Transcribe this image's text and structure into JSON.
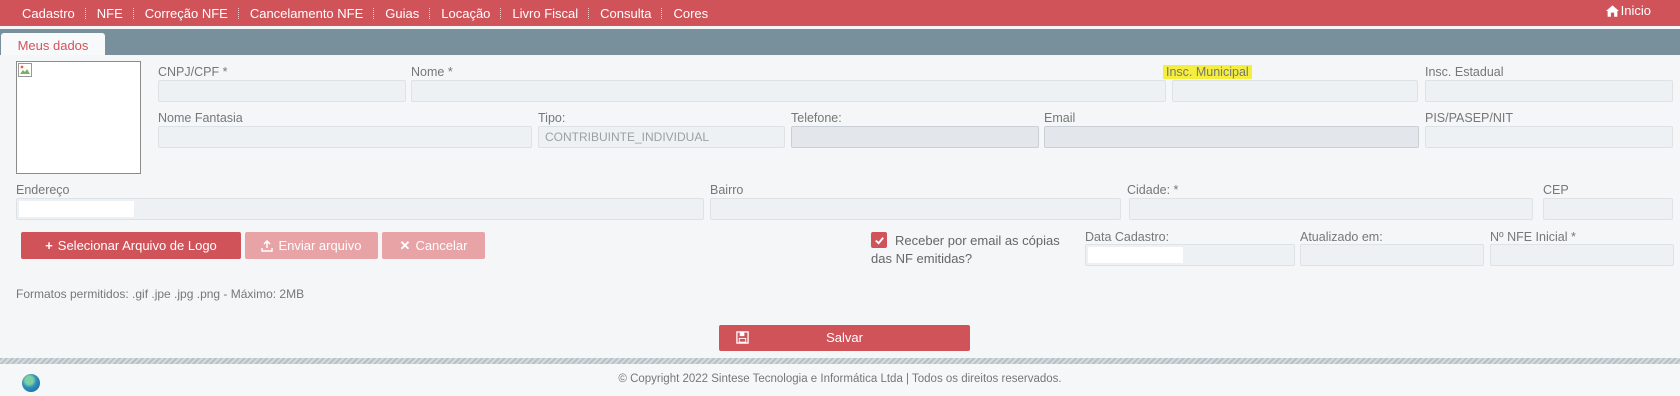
{
  "menu": [
    "Cadastro",
    "NFE",
    "Correção NFE",
    "Cancelamento NFE",
    "Guias",
    "Locação",
    "Livro Fiscal",
    "Consulta",
    "Cores"
  ],
  "home_label": "Inicio",
  "home_icon": "home-icon",
  "tab_label": "Meus dados",
  "fields": {
    "cnpj": {
      "label": "CNPJ/CPF *",
      "value": ""
    },
    "nome": {
      "label": "Nome *",
      "value": ""
    },
    "insc_municipal": {
      "label": "Insc. Municipal",
      "value": ""
    },
    "insc_estadual": {
      "label": "Insc. Estadual",
      "value": ""
    },
    "nome_fantasia": {
      "label": "Nome Fantasia",
      "value": ""
    },
    "tipo": {
      "label": "Tipo:",
      "value": "CONTRIBUINTE_INDIVIDUAL"
    },
    "telefone": {
      "label": "Telefone:",
      "value": ""
    },
    "email": {
      "label": "Email",
      "value": ""
    },
    "pis": {
      "label": "PIS/PASEP/NIT",
      "value": ""
    },
    "endereco": {
      "label": "Endereço",
      "value": ""
    },
    "bairro": {
      "label": "Bairro",
      "value": ""
    },
    "cidade": {
      "label": "Cidade: *",
      "value": ""
    },
    "cep": {
      "label": "CEP",
      "value": ""
    },
    "data_cadastro": {
      "label": "Data Cadastro:",
      "value": ""
    },
    "atualizado": {
      "label": "Atualizado em:",
      "value": ""
    },
    "nfe_inicial": {
      "label": "Nº NFE Inicial *",
      "value": ""
    }
  },
  "buttons": {
    "select_logo": "Selecionar Arquivo de Logo",
    "send_file": "Enviar arquivo",
    "cancel": "Cancelar",
    "save": "Salvar"
  },
  "checkbox": {
    "label": "Receber por email as cópias das NF emitidas?",
    "checked": true
  },
  "hint": "Formatos permitidos: .gif .jpe .jpg .png - Máximo: 2MB",
  "footer": "© Copyright 2022 Sintese Tecnologia e Informática Ltda | Todos os direitos reservados.",
  "colors": {
    "accent": "#d1535a",
    "tab_band": "#78909c",
    "highlight": "#f5ee3c"
  }
}
